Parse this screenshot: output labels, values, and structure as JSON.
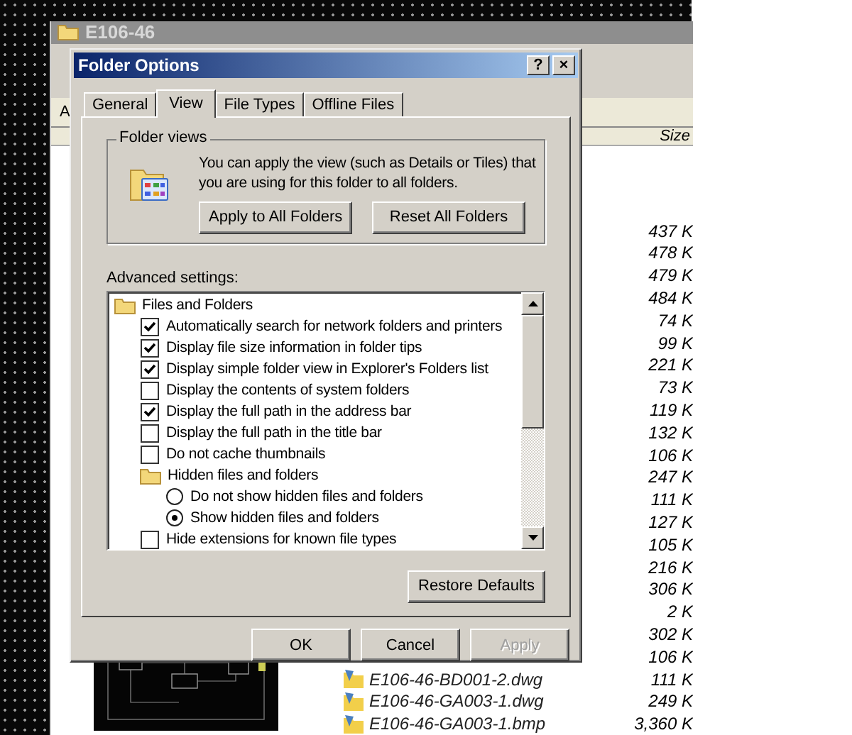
{
  "explorer": {
    "title": "E106-46",
    "address_label": "A",
    "size_header": "Size",
    "files": [
      {
        "size": "437 K"
      },
      {
        "size": "478 K"
      },
      {
        "size": "479 K"
      },
      {
        "size": "484 K"
      },
      {
        "size": "74 K"
      },
      {
        "size": "99 K"
      },
      {
        "size": "221 K"
      },
      {
        "size": "73 K"
      },
      {
        "size": "119 K"
      },
      {
        "size": "132 K"
      },
      {
        "size": "106 K"
      },
      {
        "size": "247 K"
      },
      {
        "size": "111 K"
      },
      {
        "size": "127 K"
      },
      {
        "size": "105 K"
      },
      {
        "size": "216 K"
      },
      {
        "size": "306 K"
      },
      {
        "size": "2 K"
      },
      {
        "size": "302 K"
      },
      {
        "size": "106 K"
      },
      {
        "name": "E106-46-BD001-2.dwg",
        "size": "111 K"
      },
      {
        "name": "E106-46-GA003-1.dwg",
        "size": "249 K"
      },
      {
        "name": "E106-46-GA003-1.bmp",
        "size": "3,360 K"
      }
    ]
  },
  "dialog": {
    "title": "Folder Options",
    "help_button": "?",
    "close_button": "×",
    "tabs": [
      {
        "label": "General",
        "selected": false
      },
      {
        "label": "View",
        "selected": true
      },
      {
        "label": "File Types",
        "selected": false
      },
      {
        "label": "Offline Files",
        "selected": false
      }
    ],
    "folder_views": {
      "label": "Folder views",
      "text": "You can apply the view (such as Details or Tiles) that you are using for this folder to all folders.",
      "buttons": [
        "Apply to All Folders",
        "Reset All Folders"
      ]
    },
    "advanced_label": "Advanced settings:",
    "settings": [
      {
        "kind": "folder",
        "label": "Files and Folders",
        "children": [
          {
            "kind": "checkbox",
            "label": "Automatically search for network folders and printers",
            "checked": true
          },
          {
            "kind": "checkbox",
            "label": "Display file size information in folder tips",
            "checked": true
          },
          {
            "kind": "checkbox",
            "label": "Display simple folder view in Explorer's Folders list",
            "checked": true
          },
          {
            "kind": "checkbox",
            "label": "Display the contents of system folders",
            "checked": false
          },
          {
            "kind": "checkbox",
            "label": "Display the full path in the address bar",
            "checked": true
          },
          {
            "kind": "checkbox",
            "label": "Display the full path in the title bar",
            "checked": false
          },
          {
            "kind": "checkbox",
            "label": "Do not cache thumbnails",
            "checked": false
          },
          {
            "kind": "folder",
            "label": "Hidden files and folders",
            "children": [
              {
                "kind": "radio",
                "label": "Do not show hidden files and folders",
                "selected": false
              },
              {
                "kind": "radio",
                "label": "Show hidden files and folders",
                "selected": true
              }
            ]
          },
          {
            "kind": "checkbox",
            "label": "Hide extensions for known file types",
            "checked": false
          }
        ]
      }
    ],
    "restore_button": "Restore Defaults",
    "buttons": [
      {
        "label": "OK",
        "disabled": false
      },
      {
        "label": "Cancel",
        "disabled": false
      },
      {
        "label": "Apply",
        "disabled": true
      }
    ]
  }
}
